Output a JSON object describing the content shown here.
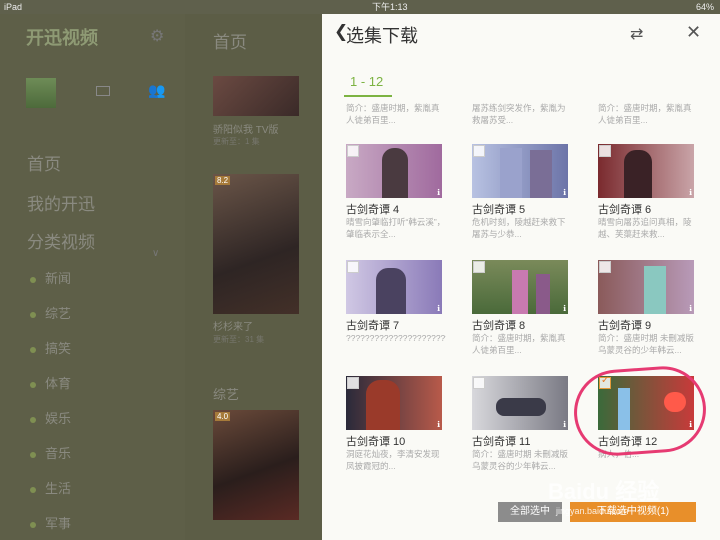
{
  "status_bar": {
    "device": "iPad",
    "time": "下午1:13",
    "battery": "64%"
  },
  "sidebar": {
    "logo": "开迅视频",
    "main_items": [
      "首页",
      "我的开迅",
      "分类视频"
    ],
    "sub_items": [
      "新闻",
      "综艺",
      "搞笑",
      "体育",
      "娱乐",
      "音乐",
      "生活",
      "军事"
    ]
  },
  "content": {
    "title": "首页",
    "posters": [
      {
        "title": "骄阳似我 TV版",
        "update": "更新至：1 集"
      },
      {
        "title": "杉杉来了",
        "update": "更新至：31 集",
        "badge": "8.2"
      }
    ],
    "section": "综艺",
    "variety_badge": "4.0"
  },
  "panel": {
    "back": "❮",
    "title": "选集下载",
    "swap_icon": "⇄",
    "close_icon": "✕",
    "range_tab": "1 - 12",
    "top_descs": [
      "简介：盛唐时期，紫胤真人徒弟百里...",
      "屠苏练剑突发作，紫胤为救屠苏受...",
      "简介：盛唐时期，紫胤真人徒弟百里..."
    ],
    "episodes": [
      {
        "title": "古剑奇谭 4",
        "desc": "晴雪向肇临打听“韩云溪”，肇临表示全...",
        "checked": false
      },
      {
        "title": "古剑奇谭 5",
        "desc": "危机时刻，陵越赶来救下屠苏与少恭...",
        "checked": false
      },
      {
        "title": "古剑奇谭 6",
        "desc": "晴雪向屠苏追问真相，陵越、芙蕖赶来救...",
        "checked": false
      },
      {
        "title": "古剑奇谭 7",
        "desc": "????????????????????????????????...",
        "checked": false
      },
      {
        "title": "古剑奇谭 8",
        "desc": "简介：盛唐时期，紫胤真人徒弟百里...",
        "checked": false
      },
      {
        "title": "古剑奇谭 9",
        "desc": "简介：盛唐时期 未刪减版 乌蒙灵谷的少年韩云...",
        "checked": false
      },
      {
        "title": "古剑奇谭 10",
        "desc": "洞庭花灿夜，李清安发现凤披霞冠的...",
        "checked": false
      },
      {
        "title": "古剑奇谭 11",
        "desc": "简介：盛唐时期 未刪减版 乌蒙灵谷的少年韩云...",
        "checked": false
      },
      {
        "title": "古剑奇谭 12",
        "desc": "病人，伯...",
        "checked": true
      }
    ]
  },
  "footer": {
    "select_all": "全部选中",
    "download": "下载选中视频(1)"
  },
  "watermark": {
    "brand": "Baidu 经验",
    "url": "jingyan.baidu.com"
  },
  "colors": {
    "accent": "#7cb342",
    "download": "#e88f2a",
    "annotation": "#e63a72"
  }
}
